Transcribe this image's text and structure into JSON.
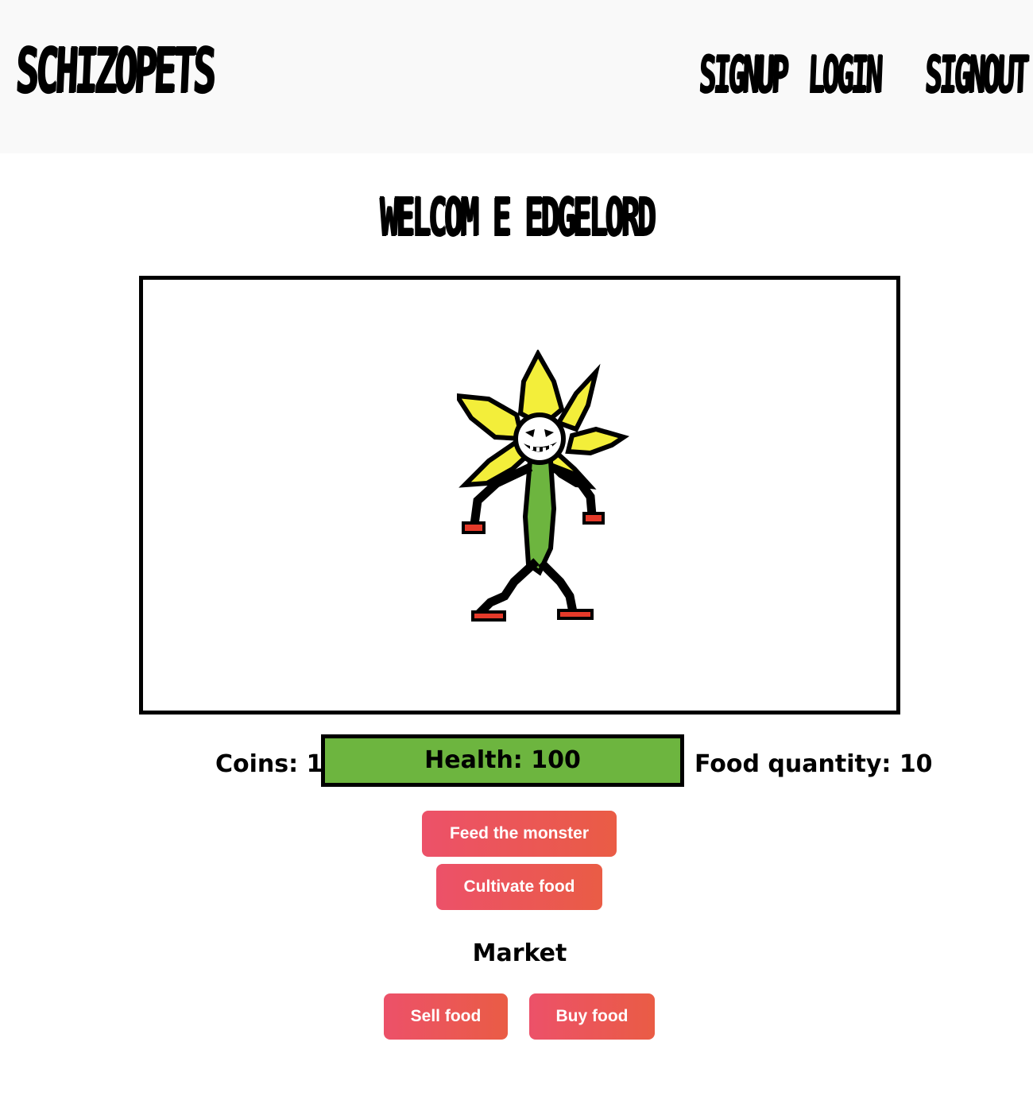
{
  "header": {
    "brand": "SCHIZOPETS",
    "nav": {
      "signup": "SIGNUP",
      "login": "LOGIN",
      "signout": "SIGNOUT"
    }
  },
  "main": {
    "welcome": "WELCOM E EDGELORD",
    "stats": {
      "coins": "Coins: 1",
      "health_label": "Health: 100",
      "health_fraction": 1.0,
      "food": "Food quantity: 10"
    },
    "actions": {
      "feed": "Feed the monster",
      "cultivate": "Cultivate food"
    },
    "market": {
      "title": "Market",
      "sell": "Sell food",
      "buy": "Buy food"
    }
  },
  "colors": {
    "health_fill": "#6db53f",
    "button_gradient_start": "#ec5169",
    "button_gradient_end": "#ea5c45",
    "header_bg": "#f9f9f9"
  },
  "icons": {
    "monster": "flower-monster-pixel-art"
  }
}
